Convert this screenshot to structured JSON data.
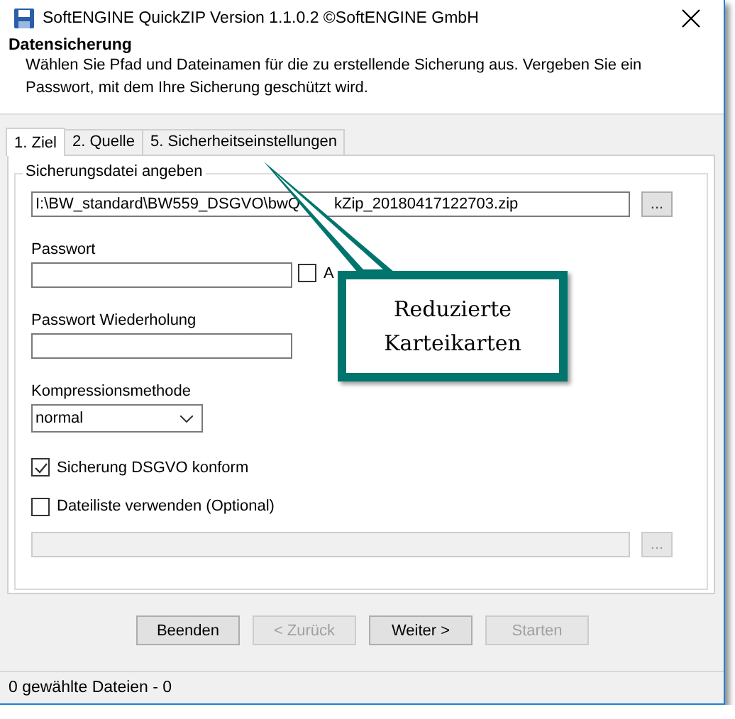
{
  "window": {
    "title": "SoftENGINE QuickZIP Version 1.1.0.2 ©SoftENGINE GmbH"
  },
  "header": {
    "title": "Datensicherung",
    "description": "Wählen Sie Pfad und Dateinamen für die zu erstellende Sicherung aus. Vergeben Sie ein Passwort, mit dem Ihre Sicherung geschützt wird."
  },
  "tabs": [
    {
      "label": "1. Ziel",
      "selected": true
    },
    {
      "label": "2. Quelle",
      "selected": false
    },
    {
      "label": "5. Sicherheitseinstellungen",
      "selected": false
    }
  ],
  "group": {
    "title": "Sicherungsdatei angeben"
  },
  "file_path": {
    "value_parts": [
      "I:\\BW_standard\\BW559_DSGVO\\bwQ",
      "kZip_20180417122703.zip"
    ],
    "browse": "..."
  },
  "password": {
    "label": "Passwort",
    "checkbox": {
      "label": "A",
      "checked": false
    }
  },
  "password_repeat": {
    "label": "Passwort Wiederholung"
  },
  "compression": {
    "label": "Kompressionsmethode",
    "value": "normal"
  },
  "options": [
    {
      "label": "Sicherung DSGVO konform",
      "checked": true
    },
    {
      "label": "Dateiliste verwenden (Optional)",
      "checked": false
    }
  ],
  "file_list": {
    "disabled": true,
    "browse": "..."
  },
  "buttons": [
    {
      "label": "Beenden",
      "disabled": false
    },
    {
      "label": "< Zurück",
      "disabled": true
    },
    {
      "label": "Weiter >",
      "disabled": false
    },
    {
      "label": "Starten",
      "disabled": true
    }
  ],
  "status_bar": "0 gewählte Dateien - 0",
  "callout": {
    "text": "Reduzierte Karteikarten"
  }
}
